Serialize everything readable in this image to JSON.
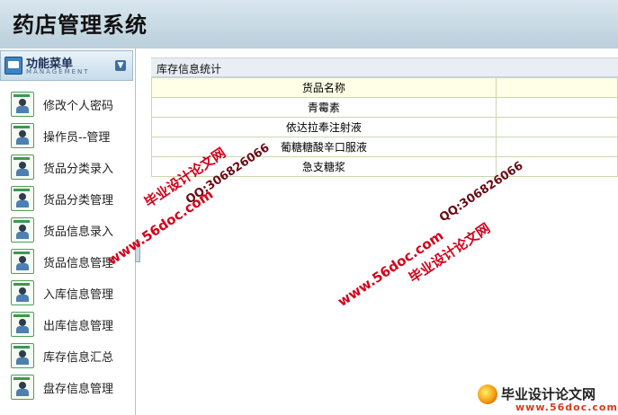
{
  "header": {
    "app_title": "药店管理系统"
  },
  "sidebar": {
    "menu_title": "功能菜单",
    "menu_subtitle": "MANAGEMENT",
    "collapse_icon": "chevron-down-icon",
    "items": [
      {
        "label": "修改个人密码",
        "icon": "user-card-icon"
      },
      {
        "label": "操作员--管理",
        "icon": "user-card-icon"
      },
      {
        "label": "货品分类录入",
        "icon": "user-card-icon"
      },
      {
        "label": "货品分类管理",
        "icon": "user-card-icon"
      },
      {
        "label": "货品信息录入",
        "icon": "user-card-icon"
      },
      {
        "label": "货品信息管理",
        "icon": "user-card-icon"
      },
      {
        "label": "入库信息管理",
        "icon": "user-card-icon"
      },
      {
        "label": "出库信息管理",
        "icon": "user-card-icon"
      },
      {
        "label": "库存信息汇总",
        "icon": "user-card-icon"
      },
      {
        "label": "盘存信息管理",
        "icon": "user-card-icon"
      }
    ]
  },
  "main": {
    "section_title": "库存信息统计",
    "table": {
      "headers": [
        "货品名称",
        ""
      ],
      "rows": [
        [
          "青霉素",
          ""
        ],
        [
          "依达拉奉注射液",
          ""
        ],
        [
          "葡糖糖酸辛口服液",
          ""
        ],
        [
          "急支糖浆",
          ""
        ]
      ]
    }
  },
  "watermark": {
    "site_name": "毕业设计论文网",
    "url": "www.56doc.com",
    "qq": "QQ:306826066"
  },
  "colors": {
    "header_bg": "#c8dae6",
    "table_header_bg": "#ffffe7",
    "watermark_red": "#d3001a",
    "icon_green": "#3e9850"
  }
}
